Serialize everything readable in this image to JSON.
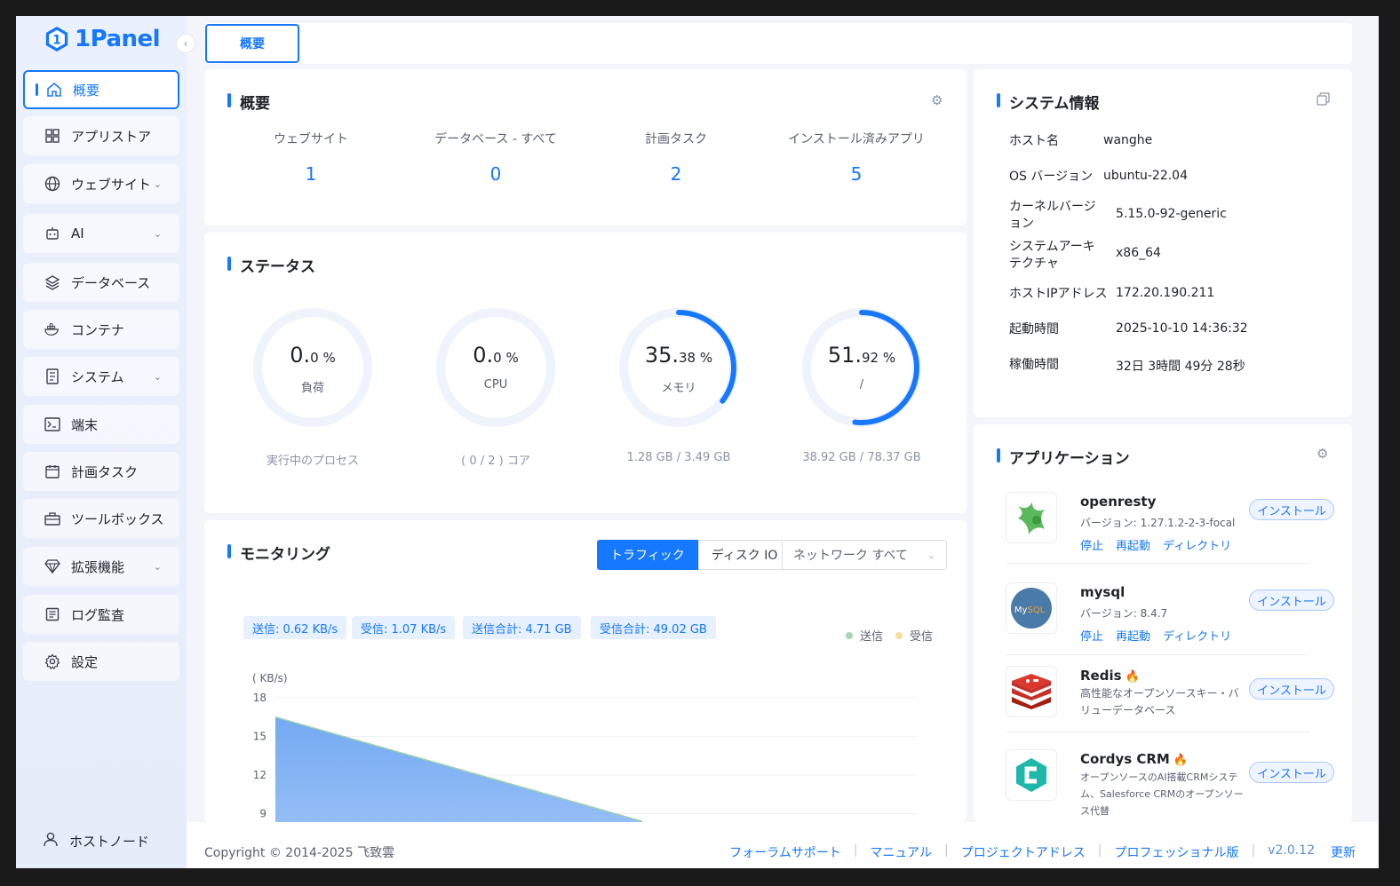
{
  "app": {
    "brand": "1Panel"
  },
  "sidebar": {
    "items": [
      {
        "label": "概要",
        "icon": "home-icon"
      },
      {
        "label": "アプリストア",
        "icon": "grid-icon"
      },
      {
        "label": "ウェブサイト",
        "icon": "globe-icon"
      },
      {
        "label": "AI",
        "icon": "robot-icon"
      },
      {
        "label": "データベース",
        "icon": "layers-icon"
      },
      {
        "label": "コンテナ",
        "icon": "docker-icon"
      },
      {
        "label": "システム",
        "icon": "server-icon"
      },
      {
        "label": "端末",
        "icon": "terminal-icon"
      },
      {
        "label": "計画タスク",
        "icon": "calendar-icon"
      },
      {
        "label": "ツールボックス",
        "icon": "toolbox-icon"
      },
      {
        "label": "拡張機能",
        "icon": "diamond-icon"
      },
      {
        "label": "ログ監査",
        "icon": "log-icon"
      },
      {
        "label": "設定",
        "icon": "gear-icon"
      }
    ],
    "host_node": "ホストノード"
  },
  "tabs": {
    "active": "概要"
  },
  "overview": {
    "title": "概要",
    "stats": [
      {
        "label": "ウェブサイト",
        "value": "1"
      },
      {
        "label": "データベース - すべて",
        "value": "0"
      },
      {
        "label": "計画タスク",
        "value": "2"
      },
      {
        "label": "インストール済みアプリ",
        "value": "5"
      }
    ]
  },
  "status": {
    "title": "ステータス",
    "gauges": [
      {
        "int": "0.",
        "dec": "0",
        "unit": " %",
        "label": "負荷",
        "footer": "実行中のプロセス",
        "percent": 0
      },
      {
        "int": "0.",
        "dec": "0",
        "unit": " %",
        "label": "CPU",
        "footer": "( 0 / 2 ) コア",
        "percent": 0
      },
      {
        "int": "35.",
        "dec": "38",
        "unit": " %",
        "label": "メモリ",
        "footer": "1.28 GB / 3.49 GB",
        "percent": 35.38
      },
      {
        "int": "51.",
        "dec": "92",
        "unit": " %",
        "label": "/",
        "footer": "38.92 GB / 78.37 GB",
        "percent": 51.92
      }
    ],
    "accent": "#1677ff"
  },
  "monitoring": {
    "title": "モニタリング",
    "tabs": [
      "トラフィック",
      "ディスク IO"
    ],
    "active_tab": "トラフィック",
    "network_select": "ネットワーク  すべて",
    "pills": [
      "送信: 0.62 KB/s",
      "受信: 1.07 KB/s",
      "送信合計: 4.71 GB",
      "受信合計: 49.02 GB"
    ],
    "legend": [
      {
        "name": "送信",
        "color": "#a8d5b4"
      },
      {
        "name": "受信",
        "color": "#f7dd9b"
      }
    ]
  },
  "chart_data": {
    "type": "area",
    "ylabel": "( KB/s)",
    "yticks": [
      18,
      15,
      12,
      9
    ],
    "ylim": [
      0,
      18
    ],
    "series": [
      {
        "name": "送信",
        "x": [
          0,
          1
        ],
        "values": [
          16.5,
          8.4
        ]
      }
    ],
    "grid": true,
    "legend": "top-right"
  },
  "system_info": {
    "title": "システム情報",
    "rows": [
      {
        "key": "ホスト名",
        "value": "wanghe"
      },
      {
        "key": "OS バージョン",
        "value": "ubuntu-22.04"
      },
      {
        "key": "カーネルバージョン",
        "value": "5.15.0-92-generic"
      },
      {
        "key": "システムアーキテクチャ",
        "value": "x86_64"
      },
      {
        "key": "ホストIPアドレス",
        "value": "172.20.190.211"
      },
      {
        "key": "起動時間",
        "value": "2025-10-10 14:36:32"
      },
      {
        "key": "稼働時間",
        "value": "32日 3時間 49分 28秒"
      }
    ]
  },
  "applications": {
    "title": "アプリケーション",
    "install_label": "インストール",
    "items": [
      {
        "name": "openresty",
        "desc": "バージョン: 1.27.1.2-2-3-focal",
        "links": [
          "停止",
          "再起動",
          "ディレクトリ"
        ]
      },
      {
        "name": "mysql",
        "desc": "バージョン: 8.4.7",
        "links": [
          "停止",
          "再起動",
          "ディレクトリ"
        ]
      },
      {
        "name": "Redis",
        "desc": "高性能なオープンソースキー・バリューデータベース",
        "hot": true
      },
      {
        "name": "Cordys CRM",
        "desc": "オープンソースのAI搭載CRMシステム、Salesforce CRMのオープンソース代替",
        "hot": true
      }
    ]
  },
  "footer": {
    "copyright": "Copyright © 2014-2025 飞致雲",
    "links": [
      "フォーラムサポート",
      "マニュアル",
      "プロジェクトアドレス",
      "プロフェッショナル版"
    ],
    "version": "v2.0.12",
    "update": "更新"
  }
}
